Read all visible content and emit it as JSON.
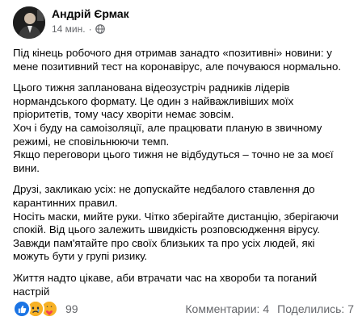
{
  "header": {
    "author": "Андрій Єрмак",
    "time": "14 мин.",
    "separator": "·",
    "audience_icon": "globe-icon"
  },
  "content": {
    "paragraphs": [
      [
        "Під кінець робочого дня отримав занадто «позитивні» новини: у",
        "мене позитивний тест на коронавірус, але почуваюся нормально."
      ],
      [
        "Цього тижня запланована відеозустріч радників лідерів",
        "нормандського формату. Це один з найважливіших моїх",
        "пріоритетів, тому часу хворіти немає зовсім.",
        "Хоч і буду на самоізоляції, але працювати планую в звичному",
        "режимі, не сповільнюючи темп.",
        "Якщо переговори цього тижня не відбудуться – точно не за моєї",
        "вини."
      ],
      [
        "Друзі, закликаю усіх: не допускайте недбалого ставлення до",
        "карантинних правил.",
        "Носіть маски, мийте руки. Чітко зберігайте дистанцію, зберігаючи",
        "спокій. Від цього залежить швидкість розповсюдження вірусу.",
        "Завжди пам'ятайте про своїх близьких та про усіх людей, які",
        "можуть бути у групі ризику."
      ],
      [
        "Життя надто цікаве, аби втрачати час на хвороби та поганий",
        "настрій"
      ]
    ]
  },
  "footer": {
    "reaction_icons": [
      "like-icon",
      "sad-icon",
      "care-icon"
    ],
    "reaction_count": "99",
    "comments": "Комментарии: 4",
    "shares": "Поделились: 7"
  },
  "colors": {
    "text": "#050505",
    "secondary": "#65676b",
    "like_blue": "#1b74e4",
    "emoji_yellow": "#f7b125"
  }
}
